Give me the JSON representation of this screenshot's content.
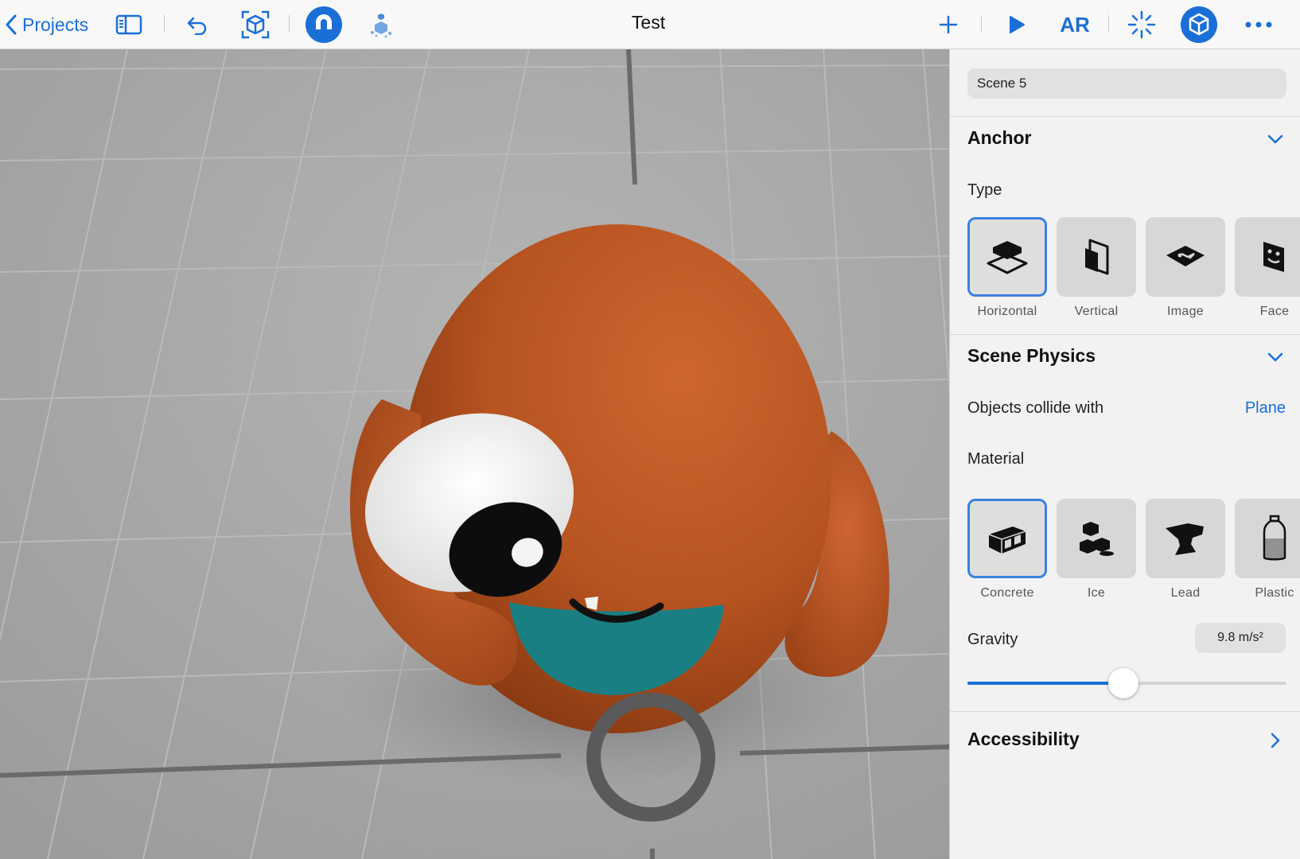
{
  "toolbar": {
    "back_label": "Projects",
    "title": "Test",
    "ar_label": "AR",
    "accent": "#1a6fd6"
  },
  "inspector": {
    "scene_name": "Scene 5",
    "anchor": {
      "title": "Anchor",
      "type_label": "Type",
      "types": [
        {
          "label": "Horizontal",
          "icon": "horizontal-plane-icon",
          "selected": true
        },
        {
          "label": "Vertical",
          "icon": "vertical-plane-icon",
          "selected": false
        },
        {
          "label": "Image",
          "icon": "image-anchor-icon",
          "selected": false
        },
        {
          "label": "Face",
          "icon": "face-anchor-icon",
          "selected": false
        }
      ]
    },
    "physics": {
      "title": "Scene Physics",
      "collide_label": "Objects collide with",
      "collide_value": "Plane",
      "material_label": "Material",
      "materials": [
        {
          "label": "Concrete",
          "icon": "concrete-block-icon",
          "selected": true
        },
        {
          "label": "Ice",
          "icon": "ice-cubes-icon",
          "selected": false
        },
        {
          "label": "Lead",
          "icon": "anvil-icon",
          "selected": false
        },
        {
          "label": "Plastic",
          "icon": "plastic-bottle-icon",
          "selected": false
        }
      ],
      "gravity_label": "Gravity",
      "gravity_value": "9.8 m/s²",
      "gravity_slider_fraction": 0.49
    },
    "accessibility": {
      "title": "Accessibility"
    }
  }
}
